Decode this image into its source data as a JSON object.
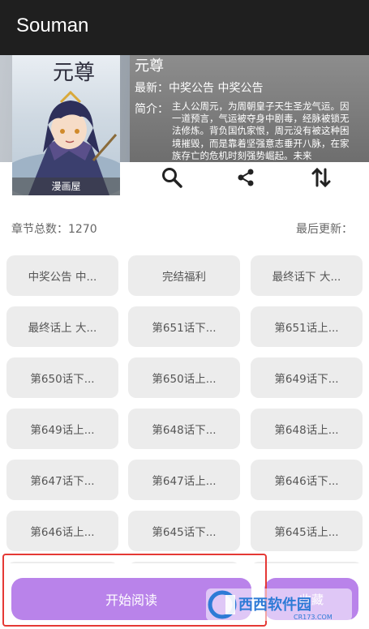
{
  "appbar": {
    "title": "Souman"
  },
  "book": {
    "title": "元尊",
    "latest": "最新：中奖公告 中奖公告",
    "intro_label": "简介：",
    "intro": "主人公周元，为周朝皇子天生圣龙气运。因一道预言，气运被夺身中剧毒，经脉被锁无法修炼。背负国仇家恨，周元没有被这种困境摧毁，而是靠着坚强意志垂开八脉，在家族存亡的危机时刻强势崛起。未来",
    "cover_caption": "漫画屋",
    "cover_calligraphy": "元尊"
  },
  "actions": {
    "search_icon": "search-icon",
    "share_icon": "share-icon",
    "sort_icon": "sort-icon"
  },
  "stats": {
    "chapter_count": "章节总数：1270",
    "last_update": "最后更新："
  },
  "chapters": [
    "中奖公告 中...",
    "完结福利",
    "最终话下 大...",
    "最终话上 大...",
    "第651话下...",
    "第651话上...",
    "第650话下...",
    "第650话上...",
    "第649话下...",
    "第649话上...",
    "第648话下...",
    "第648话上...",
    "第647话下...",
    "第647话上...",
    "第646话下...",
    "第646话上...",
    "第645话下...",
    "第645话上...",
    "",
    "",
    ""
  ],
  "buttons": {
    "start_reading": "开始阅读",
    "favorite": "收藏"
  },
  "watermark": {
    "text": "西西软件园",
    "url": "CR173.COM"
  },
  "colors": {
    "accent": "#b983ea",
    "appbar": "#1f1f1f",
    "chip": "#ececec",
    "highlight": "#e53935"
  }
}
